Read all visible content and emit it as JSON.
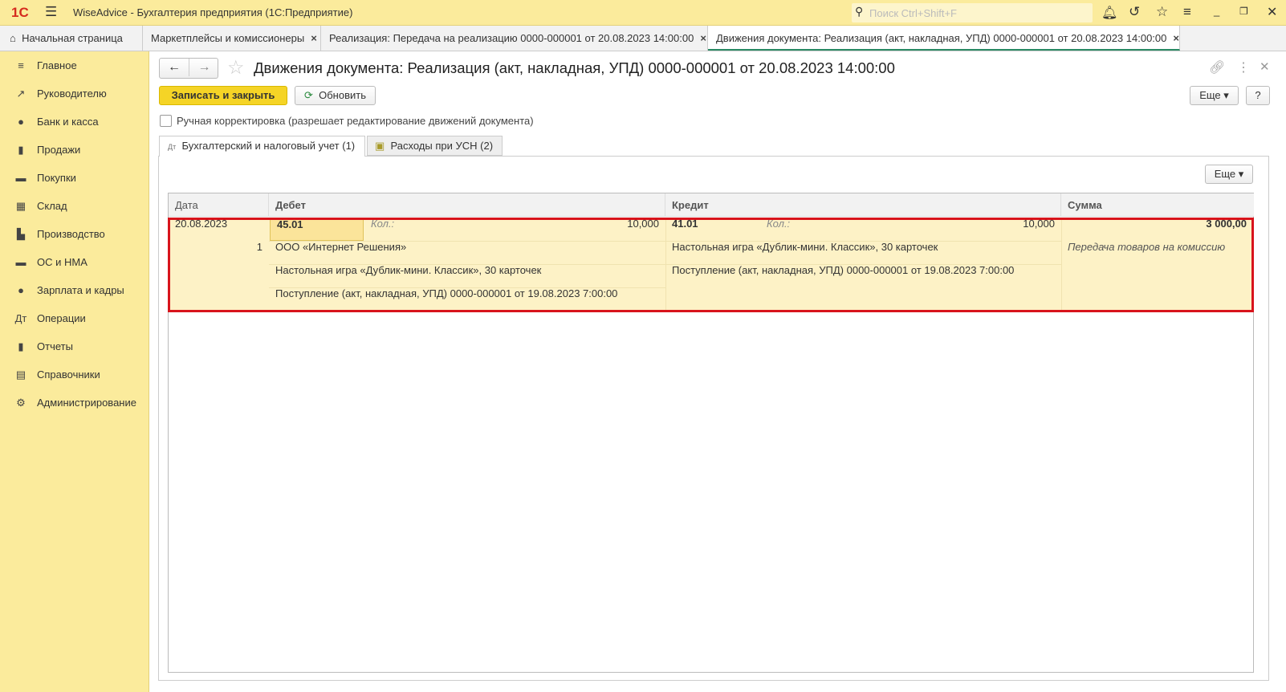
{
  "app": {
    "title": "WiseAdvice - Бухгалтерия предприятия  (1С:Предприятие)",
    "logo": "1С",
    "search_placeholder": "Поиск Ctrl+Shift+F"
  },
  "tabs": [
    {
      "label": "Начальная страница"
    },
    {
      "label": "Маркетплейсы и комиссионеры"
    },
    {
      "label": "Реализация: Передача на реализацию 0000-000001 от 20.08.2023 14:00:00"
    },
    {
      "label": "Движения документа: Реализация (акт, накладная, УПД) 0000-000001 от 20.08.2023 14:00:00"
    }
  ],
  "sidebar": {
    "items": [
      {
        "label": "Главное",
        "icon": "≡"
      },
      {
        "label": "Руководителю",
        "icon": "↗"
      },
      {
        "label": "Банк и касса",
        "icon": "●"
      },
      {
        "label": "Продажи",
        "icon": "▮"
      },
      {
        "label": "Покупки",
        "icon": "▬"
      },
      {
        "label": "Склад",
        "icon": "▦"
      },
      {
        "label": "Производство",
        "icon": "▙"
      },
      {
        "label": "ОС и НМА",
        "icon": "▬"
      },
      {
        "label": "Зарплата и кадры",
        "icon": "●"
      },
      {
        "label": "Операции",
        "icon": "Дт"
      },
      {
        "label": "Отчеты",
        "icon": "▮"
      },
      {
        "label": "Справочники",
        "icon": "▤"
      },
      {
        "label": "Администрирование",
        "icon": "⚙"
      }
    ]
  },
  "header": {
    "title": "Движения документа: Реализация (акт, накладная, УПД) 0000-000001 от 20.08.2023 14:00:00"
  },
  "toolbar": {
    "save_close": "Записать и закрыть",
    "refresh": "Обновить",
    "more": "Еще",
    "help": "?"
  },
  "manual": {
    "label": "Ручная корректировка (разрешает редактирование движений документа)",
    "checked": false
  },
  "doc_tabs": [
    {
      "label": "Бухгалтерский и налоговый учет (1)"
    },
    {
      "label": "Расходы при УСН (2)"
    }
  ],
  "panel": {
    "more": "Еще"
  },
  "table": {
    "headers": [
      "Дата",
      "Дебет",
      "Кредит",
      "Сумма"
    ],
    "row": {
      "date": "20.08.2023",
      "num": "1",
      "debit_account": "45.01",
      "qty_label": "Кол.:",
      "debit_qty": "10,000",
      "credit_account": "41.01",
      "credit_qty": "10,000",
      "sum": "3 000,00",
      "debit_sub": [
        "ООО «Интернет Решения»",
        "Настольная игра «Дублик-мини. Классик», 30 карточек",
        "Поступление (акт, накладная, УПД) 0000-000001 от 19.08.2023 7:00:00"
      ],
      "credit_sub": [
        "Настольная игра «Дублик-мини. Классик», 30 карточек",
        "Поступление (акт, накладная, УПД) 0000-000001 от 19.08.2023 7:00:00"
      ],
      "content": "Передача товаров на комиссию"
    }
  }
}
